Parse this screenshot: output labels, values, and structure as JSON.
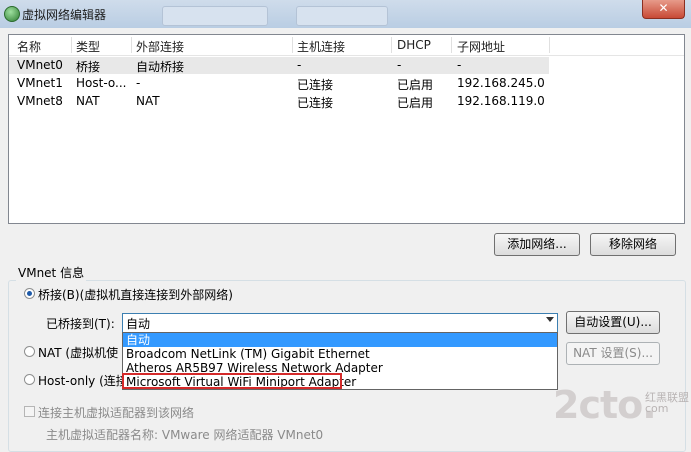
{
  "window": {
    "title": "虚拟网络编辑器",
    "close_label": "✕"
  },
  "columns": [
    "名称",
    "类型",
    "外部连接",
    "主机连接",
    "DHCP",
    "子网地址"
  ],
  "networks": [
    {
      "name": "VMnet0",
      "type": "桥接",
      "external": "自动桥接",
      "host": "-",
      "dhcp": "-",
      "subnet": "-"
    },
    {
      "name": "VMnet1",
      "type": "Host-o...",
      "external": "-",
      "host": "已连接",
      "dhcp": "已启用",
      "subnet": "192.168.245.0"
    },
    {
      "name": "VMnet8",
      "type": "NAT",
      "external": "NAT",
      "host": "已连接",
      "dhcp": "已启用",
      "subnet": "192.168.119.0"
    }
  ],
  "buttons": {
    "add_network": "添加网络...",
    "remove_network": "移除网络"
  },
  "vmnet_info": {
    "group_label": "VMnet 信息",
    "bridge_radio": "桥接(B)(虚拟机直接连接到外部网络)",
    "bridged_to_label": "已桥接到(T):",
    "bridged_to_value": "自动",
    "auto_settings": "自动设置(U)...",
    "nat_radio": "NAT (虚拟机使",
    "nat_settings": "NAT 设置(S)...",
    "hostonly_radio": "Host-only (连接",
    "connect_host_adapter": "连接主机虚拟适配器到该网络",
    "adapter_name_line": "主机虚拟适配器名称: VMware 网络适配器 VMnet0"
  },
  "dropdown_options": [
    "自动",
    "Broadcom NetLink (TM) Gigabit Ethernet",
    "Atheros AR5B97 Wireless Network Adapter",
    "Microsoft Virtual WiFi Miniport Adapter"
  ],
  "watermark": {
    "logo": "2cto.",
    "site_cn": "红黑联盟",
    "site_cn2": "com"
  },
  "colors": {
    "highlight": "#3399ff",
    "annotation_red": "#d42a2a"
  }
}
